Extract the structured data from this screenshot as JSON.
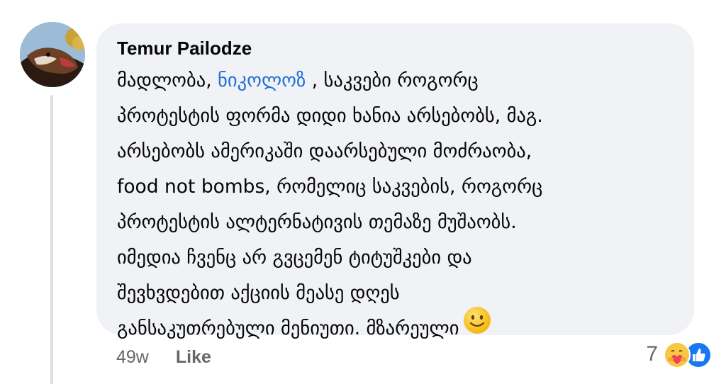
{
  "comment": {
    "author": "Temur Pailodze",
    "mention": "ნიკოლოზ",
    "lines": [
      [
        "მადლობა, ",
        " , საკვები როგორც"
      ],
      "პროტესტის ფორმა დიდი ხანია არსებობს, მაგ.",
      "არსებობს ამერიკაში დაარსებული მოძრაობა,",
      "food not bombs, რომელიც საკვების, როგორც",
      "პროტესტის ალტერნატივის თემაზე მუშაობს.",
      "იმედია ჩვენც არ გვცემენ ტიტუშკები და",
      "შევხვდებით აქციის მეასე დღეს",
      "განსაკუთრებული მენიუთი. მზარეული"
    ],
    "line1_before": "მადლობა, ",
    "line1_after": " , საკვები როგორც",
    "line2": "პროტესტის ფორმა დიდი ხანია არსებობს, მაგ.",
    "line3": "არსებობს ამერიკაში დაარსებული მოძრაობა,",
    "line4": "food not bombs, რომელიც საკვების, როგორც",
    "line5": "პროტესტის ალტერნატივის თემაზე მუშაობს.",
    "line6": "იმედია ჩვენც არ გვცემენ ტიტუშკები და",
    "line7": "შევხვდებით აქციის მეასე დღეს",
    "line8": "განსაკუთრებული მენიუთი. მზარეული",
    "emoji": "slightly-smiling-face-icon"
  },
  "meta": {
    "time": "49w",
    "like_label": "Like"
  },
  "reactions": {
    "count": "7",
    "icons": [
      "care-reaction-icon",
      "like-reaction-icon"
    ]
  },
  "colors": {
    "bubble_bg": "#f0f2f5",
    "mention": "#216fdb",
    "meta_text": "#65676b",
    "like_blue": "#1877f2"
  }
}
